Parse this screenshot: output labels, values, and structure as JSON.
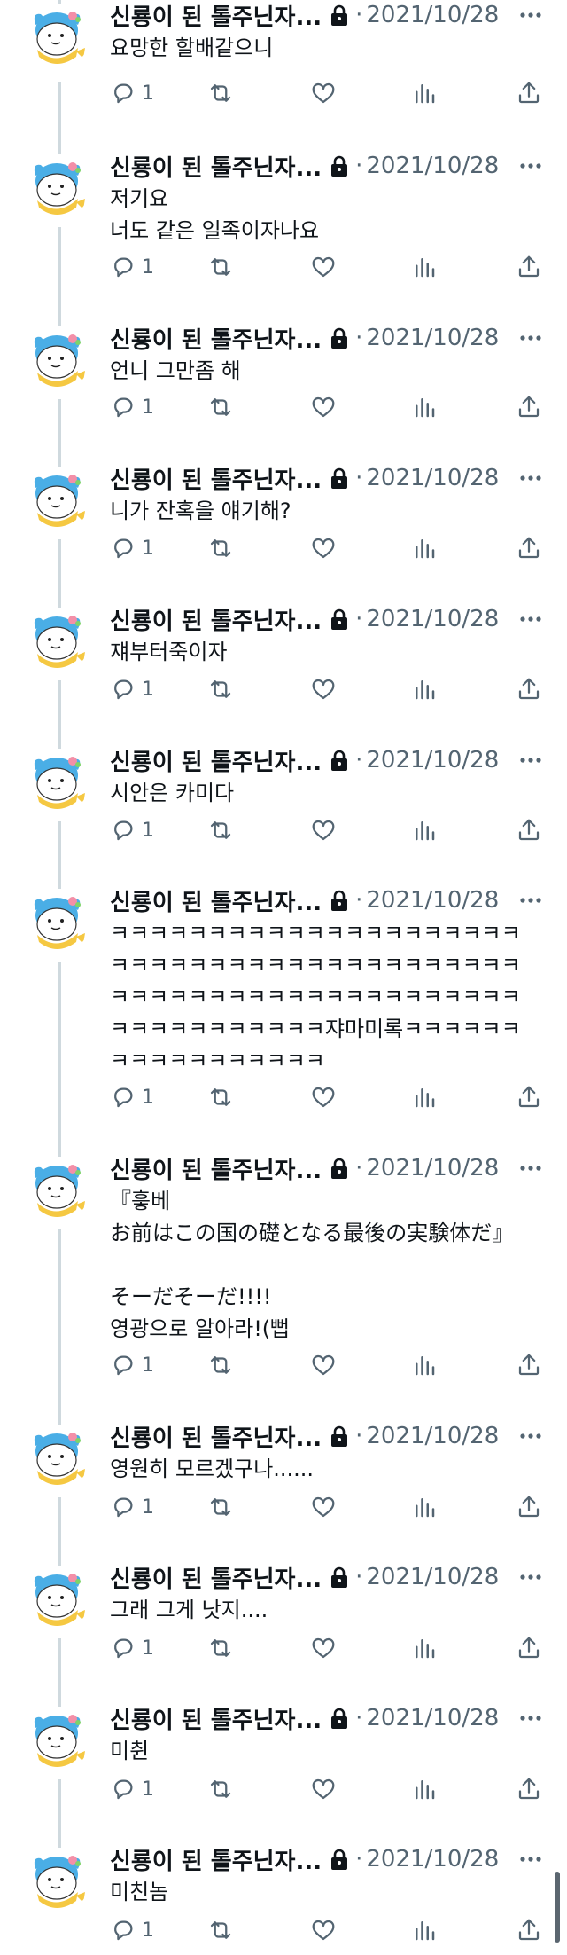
{
  "author": {
    "display_name": "신룡이 된 톨주닌자...",
    "separator": "·",
    "date": "2021/10/28",
    "protected_icon": "lock-icon",
    "avatar_icon": "blue-dragon-avatar"
  },
  "colors": {
    "text_primary": "#0f1419",
    "text_secondary": "#536471",
    "thread_line": "#cfd9de",
    "avatar_blue": "#4aaee6",
    "avatar_scarf": "#f5c842"
  },
  "action_icons": [
    "reply-icon",
    "retweet-icon",
    "like-icon",
    "analytics-icon",
    "share-icon"
  ],
  "tweets": [
    {
      "text": "요망한 할배같으니",
      "reply_count": "1"
    },
    {
      "text": "저기요\n너도 같은 일족이자나요",
      "reply_count": "1"
    },
    {
      "text": "언니 그만좀 해",
      "reply_count": "1"
    },
    {
      "text": "니가 잔혹을 얘기해?",
      "reply_count": "1"
    },
    {
      "text": "쟤부터죽이자",
      "reply_count": "1"
    },
    {
      "text": "시안은 카미다",
      "reply_count": "1"
    },
    {
      "text": "ㅋㅋㅋㅋㅋㅋㅋㅋㅋㅋㅋㅋㅋㅋㅋㅋㅋㅋㅋㅋㅋㅋㅋㅋㅋㅋㅋㅋㅋㅋㅋㅋㅋㅋㅋㅋㅋㅋㅋㅋㅋㅋㅋㅋㅋㅋㅋㅋㅋㅋㅋㅋㅋㅋㅋㅋㅋㅋㅋㅋㅋㅋㅋㅋㅋㅋㅋㅋㅋㅋㅋㅋㅋㅋ쟈마미록ㅋㅋㅋㅋㅋㅋㅋㅋㅋㅋㅋㅋㅋㅋㅋㅋㅋ",
      "reply_count": "1"
    },
    {
      "text": "『흫베\nお前はこの国の礎となる最後の実験体だ』\n\nそーだそーだ!!!!\n영광으로 알아라!(뻡",
      "reply_count": "1"
    },
    {
      "text": "영원히 모르겠구나......",
      "reply_count": "1"
    },
    {
      "text": "그래 그게 낫지....",
      "reply_count": "1"
    },
    {
      "text": "미췬",
      "reply_count": "1"
    },
    {
      "text": "미친놈",
      "reply_count": "1"
    }
  ]
}
